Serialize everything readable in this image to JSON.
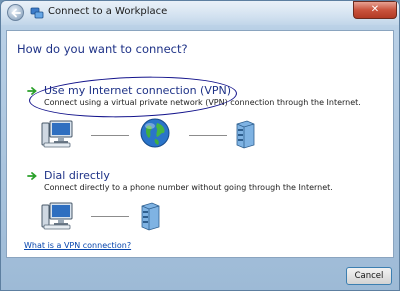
{
  "window": {
    "title": "Connect to a Workplace",
    "close_symbol": "✕"
  },
  "main": {
    "heading": "How do you want to connect?",
    "options": [
      {
        "title": "Use my Internet connection (VPN)",
        "description": "Connect using a virtual private network (VPN) connection through the Internet.",
        "icons": [
          "computer-icon",
          "globe-icon",
          "server-icon"
        ]
      },
      {
        "title": "Dial directly",
        "description": "Connect directly to a phone number without going through the Internet.",
        "icons": [
          "computer-icon",
          "server-icon"
        ]
      }
    ],
    "help_link": "What is a VPN connection?"
  },
  "footer": {
    "cancel_label": "Cancel"
  },
  "colors": {
    "heading": "#1e3287",
    "link": "#0645ad",
    "arrow": "#2aa02a",
    "annotation_circle": "#14148c"
  }
}
